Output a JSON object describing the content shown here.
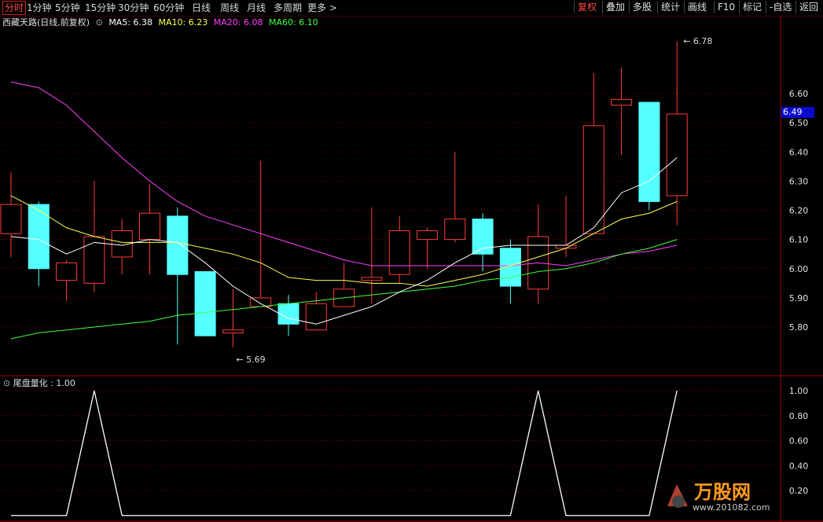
{
  "toolbar": {
    "left": [
      "分时",
      "1分钟",
      "5分钟",
      "15分钟",
      "30分钟",
      "60分钟",
      "日线",
      "周线",
      "月线",
      "多周期",
      "更多 >"
    ],
    "active_left": 0,
    "right": [
      "复权",
      "叠加",
      "多股",
      "统计",
      "画线",
      "F10",
      "标记",
      "-自选",
      "返回"
    ],
    "active_right": 0
  },
  "header": {
    "stock": "西藏天路(日线,前复权)",
    "ma5": "MA5: 6.38",
    "ma10": "MA10: 6.23",
    "ma20": "MA20: 6.08",
    "ma60": "MA60: 6.10"
  },
  "colors": {
    "up": "#ff3b3b",
    "down": "#54ffff",
    "ma5": "#ffffff",
    "ma10": "#ffff50",
    "ma20": "#ff40ff",
    "ma60": "#40ff40",
    "grid": "#7a0000",
    "axis_text": "#e0e0e0"
  },
  "price_axis": [
    "6.60",
    "6.50",
    "6.40",
    "6.30",
    "6.20",
    "6.10",
    "6.00",
    "5.90",
    "5.80"
  ],
  "current_price": "6.49",
  "annotations": {
    "high": "6.78",
    "low": "5.69"
  },
  "sub": {
    "title": "尾盘量化 : 1.00",
    "axis": [
      "1.00",
      "0.80",
      "0.60",
      "0.40",
      "0.20"
    ]
  },
  "chart_data": {
    "type": "candlestick",
    "ylim": [
      5.69,
      6.78
    ],
    "candles": [
      {
        "o": 6.12,
        "c": 6.22,
        "h": 6.33,
        "l": 6.04
      },
      {
        "o": 6.22,
        "c": 6.0,
        "h": 6.23,
        "l": 5.94
      },
      {
        "o": 5.96,
        "c": 6.02,
        "h": 6.03,
        "l": 5.89
      },
      {
        "o": 5.95,
        "c": 6.11,
        "h": 6.3,
        "l": 5.92
      },
      {
        "o": 6.04,
        "c": 6.13,
        "h": 6.17,
        "l": 5.98
      },
      {
        "o": 6.1,
        "c": 6.19,
        "h": 6.29,
        "l": 5.98
      },
      {
        "o": 6.18,
        "c": 5.98,
        "h": 6.21,
        "l": 5.74
      },
      {
        "o": 5.99,
        "c": 5.77,
        "h": 5.99,
        "l": 5.77
      },
      {
        "o": 5.78,
        "c": 5.79,
        "h": 5.93,
        "l": 5.73
      },
      {
        "o": 5.87,
        "c": 5.9,
        "h": 6.37,
        "l": 5.87
      },
      {
        "o": 5.88,
        "c": 5.81,
        "h": 5.91,
        "l": 5.77
      },
      {
        "o": 5.79,
        "c": 5.88,
        "h": 5.92,
        "l": 5.79
      },
      {
        "o": 5.87,
        "c": 5.93,
        "h": 6.02,
        "l": 5.87
      },
      {
        "o": 5.96,
        "c": 5.97,
        "h": 6.21,
        "l": 5.88
      },
      {
        "o": 5.98,
        "c": 6.13,
        "h": 6.18,
        "l": 5.95
      },
      {
        "o": 6.1,
        "c": 6.13,
        "h": 6.14,
        "l": 6.0
      },
      {
        "o": 6.1,
        "c": 6.17,
        "h": 6.4,
        "l": 6.09
      },
      {
        "o": 6.17,
        "c": 6.05,
        "h": 6.19,
        "l": 5.99
      },
      {
        "o": 6.07,
        "c": 5.94,
        "h": 6.1,
        "l": 5.88
      },
      {
        "o": 5.93,
        "c": 6.11,
        "h": 6.22,
        "l": 5.88
      },
      {
        "o": 6.07,
        "c": 6.08,
        "h": 6.25,
        "l": 6.04
      },
      {
        "o": 6.12,
        "c": 6.49,
        "h": 6.67,
        "l": 6.12
      },
      {
        "o": 6.56,
        "c": 6.58,
        "h": 6.69,
        "l": 6.39
      },
      {
        "o": 6.57,
        "c": 6.23,
        "h": 6.57,
        "l": 6.2
      },
      {
        "o": 6.25,
        "c": 6.53,
        "h": 6.78,
        "l": 6.15
      }
    ],
    "ma5": [
      6.11,
      6.1,
      6.05,
      6.09,
      6.08,
      6.1,
      6.09,
      6.02,
      5.94,
      5.88,
      5.83,
      5.81,
      5.84,
      5.87,
      5.92,
      5.96,
      6.02,
      6.07,
      6.08,
      6.08,
      6.08,
      6.14,
      6.26,
      6.3,
      6.38
    ],
    "ma10": [
      6.25,
      6.2,
      6.14,
      6.11,
      6.09,
      6.09,
      6.09,
      6.07,
      6.05,
      6.02,
      5.97,
      5.96,
      5.96,
      5.95,
      5.95,
      5.94,
      5.96,
      5.98,
      6.01,
      6.04,
      6.07,
      6.12,
      6.17,
      6.19,
      6.23
    ],
    "ma20": [
      6.64,
      6.62,
      6.56,
      6.47,
      6.38,
      6.3,
      6.23,
      6.18,
      6.15,
      6.12,
      6.09,
      6.06,
      6.03,
      6.01,
      6.01,
      6.01,
      6.01,
      6.01,
      6.01,
      6.02,
      6.01,
      6.03,
      6.05,
      6.06,
      6.08
    ],
    "ma60": [
      5.76,
      5.78,
      5.79,
      5.8,
      5.81,
      5.82,
      5.84,
      5.85,
      5.86,
      5.87,
      5.88,
      5.89,
      5.9,
      5.91,
      5.92,
      5.93,
      5.94,
      5.96,
      5.97,
      5.99,
      6.0,
      6.02,
      6.05,
      6.07,
      6.1
    ],
    "signal": [
      0,
      0,
      0,
      1,
      0,
      0,
      0,
      0,
      0,
      0,
      0,
      0,
      0,
      0,
      0,
      0,
      0,
      0,
      0,
      1,
      0,
      0,
      0,
      0,
      1
    ]
  }
}
